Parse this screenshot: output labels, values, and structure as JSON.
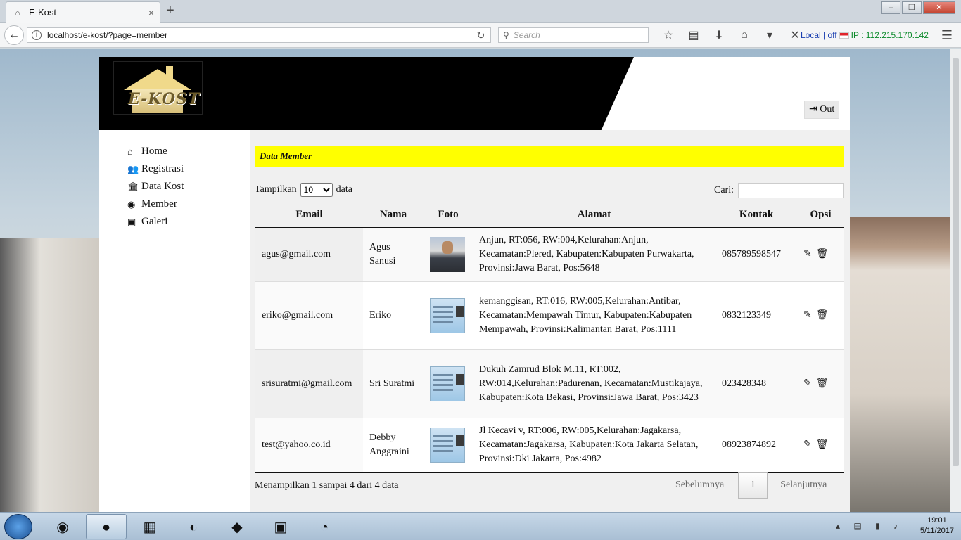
{
  "browser": {
    "tab_title": "E-Kost",
    "tab_close": "×",
    "new_tab": "+",
    "url": "localhost/e-kost/?page=member",
    "search_placeholder": "Search",
    "ip_local": "Local | off",
    "ip_text": "IP : 112.215.170.142",
    "back_icon": "arrow-left-icon",
    "window_buttons": [
      "minimize",
      "restore",
      "close"
    ]
  },
  "header": {
    "logo_text": "E-KOST",
    "out_label": "Out"
  },
  "sidebar": {
    "items": [
      {
        "label": "Home",
        "icon": "home-icon",
        "glyph": "⌂"
      },
      {
        "label": "Registrasi",
        "icon": "users-icon",
        "glyph": "👥"
      },
      {
        "label": "Data Kost",
        "icon": "bank-icon",
        "glyph": "🏛"
      },
      {
        "label": "Member",
        "icon": "user-circle-icon",
        "glyph": "◉"
      },
      {
        "label": "Galeri",
        "icon": "image-icon",
        "glyph": "▣"
      }
    ]
  },
  "content": {
    "banner": "Data Member",
    "show_label": "Tampilkan",
    "show_value": "10",
    "show_suffix": "data",
    "search_label": "Cari:",
    "search_value": "",
    "columns": [
      "Email",
      "Nama",
      "Foto",
      "Alamat",
      "Kontak",
      "Opsi"
    ],
    "rows": [
      {
        "email": "agus@gmail.com",
        "nama": "Agus Sanusi",
        "foto": "photo",
        "alamat": "Anjun, RT:056, RW:004,Kelurahan:Anjun, Kecamatan:Plered, Kabupaten:Kabupaten Purwakarta, Provinsi:Jawa Barat, Pos:5648",
        "kontak": "085789598547"
      },
      {
        "email": "eriko@gmail.com",
        "nama": "Eriko",
        "foto": "ktp",
        "alamat": "kemanggisan, RT:016, RW:005,Kelurahan:Antibar, Kecamatan:Mempawah Timur, Kabupaten:Kabupaten Mempawah, Provinsi:Kalimantan Barat, Pos:1111",
        "kontak": "0832123349"
      },
      {
        "email": "srisuratmi@gmail.com",
        "nama": "Sri Suratmi",
        "foto": "ktp",
        "alamat": "Dukuh Zamrud Blok M.11, RT:002, RW:014,Kelurahan:Padurenan, Kecamatan:Mustikajaya, Kabupaten:Kota Bekasi, Provinsi:Jawa Barat, Pos:3423",
        "kontak": "023428348"
      },
      {
        "email": "test@yahoo.co.id",
        "nama": "Debby Anggraini",
        "foto": "ktp",
        "alamat": "Jl Kecavi v, RT:006, RW:005,Kelurahan:Jagakarsa, Kecamatan:Jagakarsa, Kabupaten:Kota Jakarta Selatan, Provinsi:Dki Jakarta, Pos:4982",
        "kontak": "08923874892"
      }
    ],
    "info": "Menampilkan 1 sampai 4 dari 4 data",
    "prev_label": "Sebelumnya",
    "current_page": "1",
    "next_label": "Selanjutnya"
  },
  "taskbar": {
    "time": "19:01",
    "date": "5/11/2017"
  }
}
